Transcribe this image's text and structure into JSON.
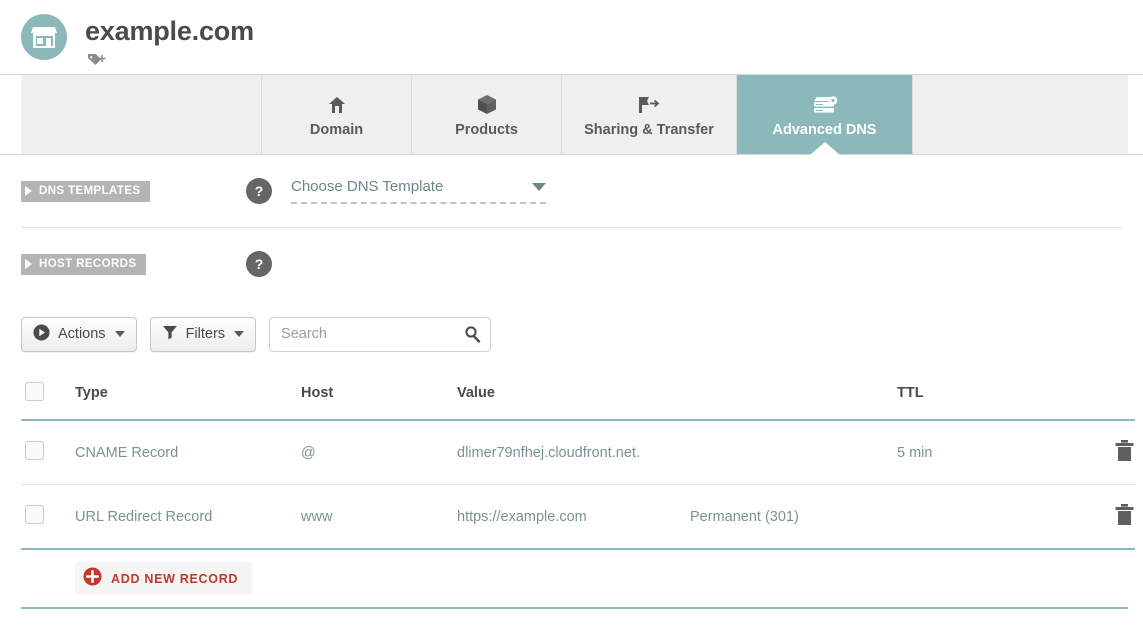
{
  "header": {
    "domain_title": "example.com",
    "logo_icon": "storefront-icon",
    "logo_bg": "#8bb9bb",
    "tag_add_icon": "tag-plus-icon"
  },
  "tabs": [
    {
      "label": "Domain",
      "icon": "home-icon",
      "active": false
    },
    {
      "label": "Products",
      "icon": "box-icon",
      "active": false
    },
    {
      "label": "Sharing & Transfer",
      "icon": "share-arrow-icon",
      "active": false
    },
    {
      "label": "Advanced DNS",
      "icon": "server-gear-icon",
      "active": true
    }
  ],
  "sections": {
    "dns_templates": {
      "ribbon_label": "DNS TEMPLATES",
      "help_label": "?",
      "select_value": "Choose DNS Template",
      "select_icon": "chevron-down-icon"
    },
    "host_records": {
      "ribbon_label": "HOST RECORDS",
      "help_label": "?"
    }
  },
  "toolbar": {
    "actions_label": "Actions",
    "actions_icon": "play-circle-icon",
    "filters_label": "Filters",
    "filters_icon": "funnel-icon",
    "search_placeholder": "Search",
    "search_value": "",
    "search_icon": "search-icon"
  },
  "table": {
    "columns": [
      "Type",
      "Host",
      "Value",
      "TTL"
    ],
    "rows": [
      {
        "type": "CNAME Record",
        "host": "@",
        "value": "dlimer79nfhej.cloudfront.net.",
        "extra": "",
        "ttl": "5 min",
        "delete_icon": "trash-icon"
      },
      {
        "type": "URL Redirect Record",
        "host": "www",
        "value": "https://example.com",
        "extra": "Permanent (301)",
        "ttl": "",
        "delete_icon": "trash-icon"
      }
    ]
  },
  "add_record": {
    "label": "ADD NEW RECORD",
    "icon": "plus-circle-icon",
    "color": "#c0392b"
  },
  "colors": {
    "accent_teal": "#8bb9bb",
    "ribbon_gray": "#b4b4b4",
    "text_gray": "#4a4a4a",
    "value_text": "#7a9295"
  }
}
